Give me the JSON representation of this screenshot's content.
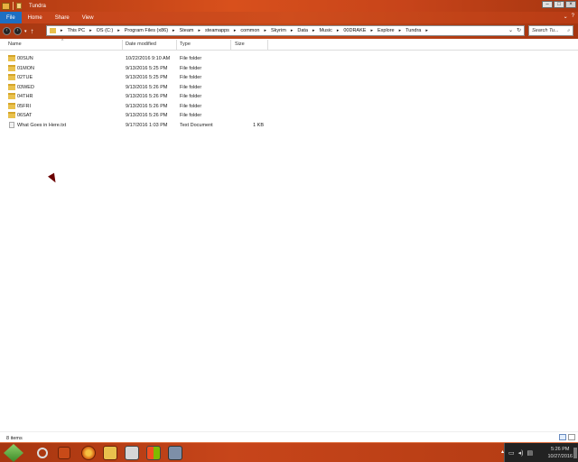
{
  "window": {
    "title": "Tundra"
  },
  "ribbon": {
    "tabs": [
      "File",
      "Home",
      "Share",
      "View"
    ]
  },
  "address": {
    "breadcrumbs": [
      "This PC",
      "OS (C:)",
      "Program Files (x86)",
      "Steam",
      "steamapps",
      "common",
      "Skyrim",
      "Data",
      "Music",
      "00DRAKE",
      "Explore",
      "Tundra"
    ],
    "search_placeholder": "Search Tu..."
  },
  "columns": {
    "name": "Name",
    "date": "Date modified",
    "type": "Type",
    "size": "Size"
  },
  "files": [
    {
      "name": "00SUN",
      "date": "10/22/2016 9:10 AM",
      "type": "File folder",
      "size": "",
      "icon": "folder-icon"
    },
    {
      "name": "01MON",
      "date": "9/13/2016 5:25 PM",
      "type": "File folder",
      "size": "",
      "icon": "folder-icon"
    },
    {
      "name": "02TUE",
      "date": "9/13/2016 5:25 PM",
      "type": "File folder",
      "size": "",
      "icon": "folder-icon"
    },
    {
      "name": "03WED",
      "date": "9/13/2016 5:26 PM",
      "type": "File folder",
      "size": "",
      "icon": "folder-icon"
    },
    {
      "name": "04THR",
      "date": "9/13/2016 5:26 PM",
      "type": "File folder",
      "size": "",
      "icon": "folder-icon"
    },
    {
      "name": "05FRI",
      "date": "9/13/2016 5:26 PM",
      "type": "File folder",
      "size": "",
      "icon": "folder-icon"
    },
    {
      "name": "06SAT",
      "date": "9/13/2016 5:26 PM",
      "type": "File folder",
      "size": "",
      "icon": "folder-icon"
    },
    {
      "name": "What Goes in Here.txt",
      "date": "9/17/2016 1:03 PM",
      "type": "Text Document",
      "size": "1 KB",
      "icon": "text-file-icon"
    }
  ],
  "status": {
    "item_count": "8 items"
  },
  "taskbar": {
    "time": "5:26 PM",
    "date": "10/27/2016"
  },
  "colors": {
    "chrome": "#c44818",
    "file_tab": "#1e6fc2",
    "folder": "#e9c14d"
  }
}
